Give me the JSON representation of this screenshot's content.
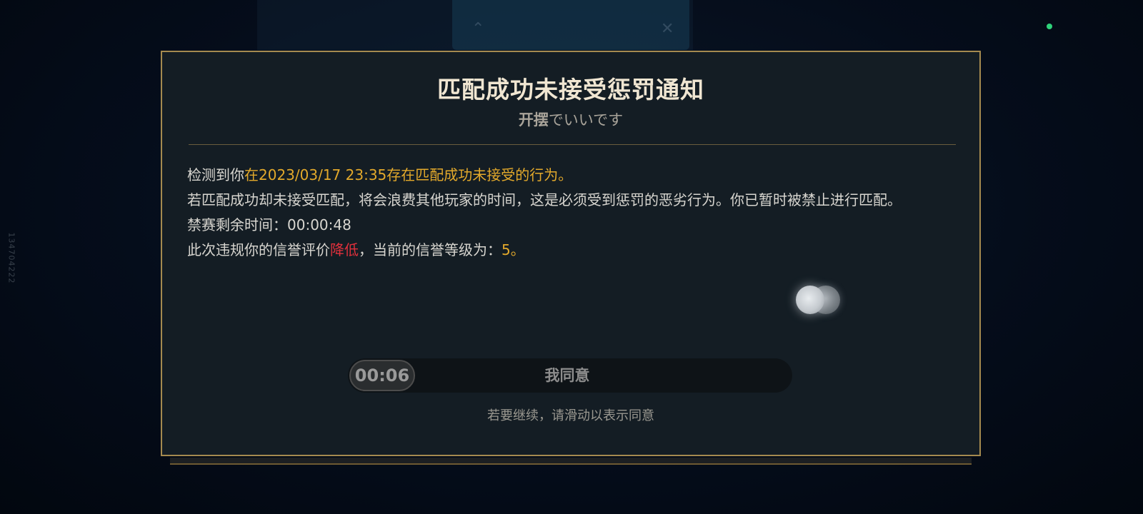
{
  "background": {
    "side_id": "134704222"
  },
  "dialog": {
    "title": "匹配成功未接受惩罚通知",
    "subtitle_bold": "开摆",
    "subtitle_rest": "でいいです",
    "lines": {
      "detect_prefix": "检测到你",
      "detect_highlight": "在2023/03/17 23:35存在匹配成功未接受的行为。",
      "warning": "若匹配成功却未接受匹配，将会浪费其他玩家的时间，这是必须受到惩罚的恶劣行为。你已暂时被禁止进行匹配。",
      "ban_remaining_label": "禁赛剩余时间：",
      "ban_remaining_value": "00:00:48",
      "credit_prefix": "此次违规你的信誉评价",
      "credit_change": "降低",
      "credit_middle": "，当前的信誉等级为：",
      "credit_level": "5",
      "credit_suffix": "。"
    },
    "slider": {
      "countdown": "00:06",
      "label": "我同意"
    },
    "hint": "若要继续，请滑动以表示同意"
  },
  "colors": {
    "accent_gold": "#e3a92b",
    "accent_red": "#e0303c",
    "border_gold": "#a58a4f",
    "status_green": "#2fd27a"
  },
  "icons": {
    "loading": "loading-orbs-icon",
    "status": "status-dot-icon"
  }
}
